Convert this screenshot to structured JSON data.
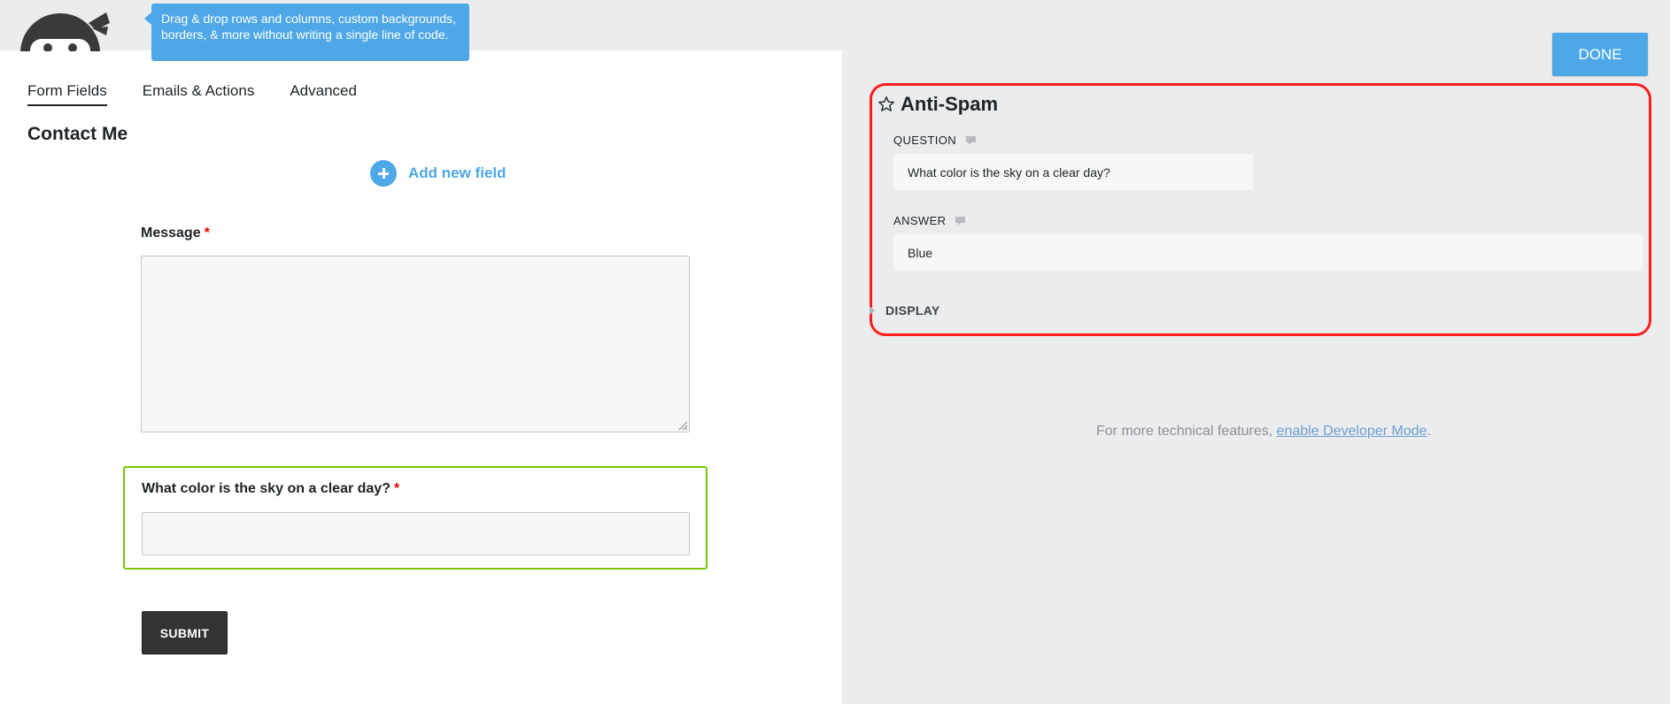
{
  "tooltip": {
    "text": "Drag & drop rows and columns, custom backgrounds, borders, & more without writing a single line of code."
  },
  "tabs": [
    {
      "label": "Form Fields",
      "active": true
    },
    {
      "label": "Emails & Actions",
      "active": false
    },
    {
      "label": "Advanced",
      "active": false
    }
  ],
  "form": {
    "title": "Contact Me",
    "add_field_label": "Add new field",
    "message_label": "Message",
    "required_marker": "*",
    "antispam_question_label": "What color is the sky on a clear day?",
    "submit_label": "SUBMIT"
  },
  "settings": {
    "done_label": "DONE",
    "title": "Anti-Spam",
    "question_label": "QUESTION",
    "question_value": "What color is the sky on a clear day?",
    "answer_label": "ANSWER",
    "answer_value": "Blue",
    "display_label": "DISPLAY"
  },
  "footer": {
    "prefix": "For more technical features, ",
    "link_text": "enable Developer Mode",
    "suffix": "."
  },
  "colors": {
    "accent": "#4ea7e6",
    "highlight_border": "#ff1c1c",
    "selected_field_border": "#78c60a",
    "required": "#e80000",
    "pane_background": "#ebecee"
  },
  "icons": {
    "logo": "ninja-logo",
    "add": "plus-circle-icon",
    "star": "star-icon",
    "help": "speech-bubble-icon",
    "caret": "caret-right-icon"
  }
}
